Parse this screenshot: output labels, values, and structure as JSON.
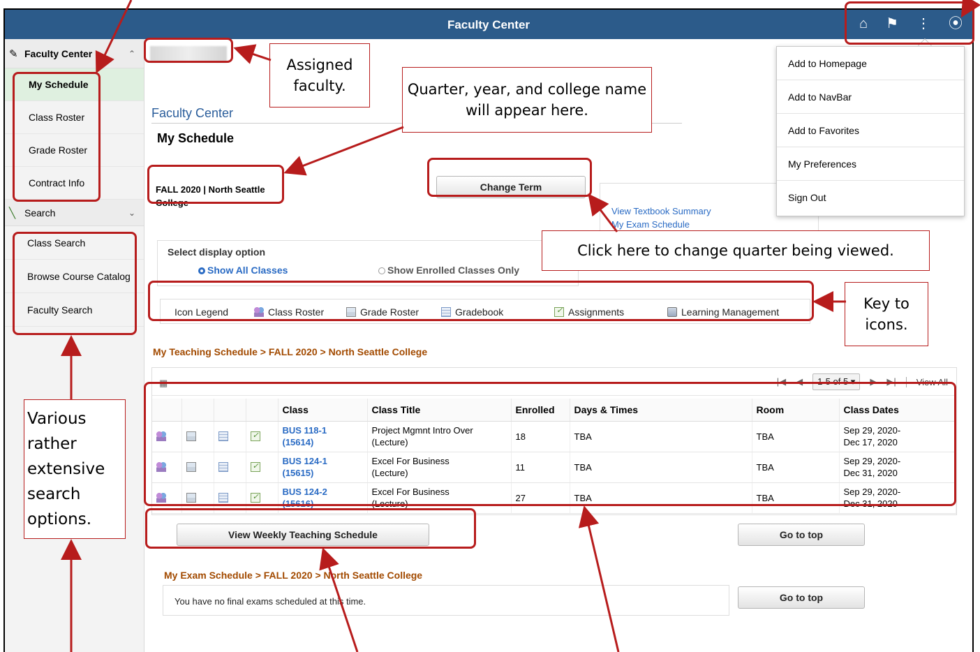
{
  "header": {
    "title": "Faculty Center"
  },
  "header_icons": [
    "home-icon",
    "flag-icon",
    "more-vertical-icon",
    "compass-icon"
  ],
  "sidebar": {
    "group_title": "Faculty Center",
    "items": [
      {
        "label": "My Schedule"
      },
      {
        "label": "Class Roster"
      },
      {
        "label": "Grade Roster"
      },
      {
        "label": "Contract Info"
      }
    ],
    "search_title": "Search",
    "search_items": [
      {
        "label": "Class Search"
      },
      {
        "label": "Browse Course Catalog"
      },
      {
        "label": "Faculty Search"
      }
    ]
  },
  "main": {
    "breadcrumb_link": "Faculty Center",
    "heading": "My Schedule",
    "term_name": "FALL 2020 | North Seattle College",
    "change_term_label": "Change Term",
    "links": {
      "textbook": "View Textbook Summary",
      "exam": "My Exam Schedule"
    },
    "display_option": {
      "label": "Select display option",
      "option_all": "Show All Classes",
      "option_enrolled": "Show Enrolled Classes Only"
    },
    "legend": {
      "title": "Icon Legend",
      "class_roster": "Class Roster",
      "grade_roster": "Grade Roster",
      "gradebook": "Gradebook",
      "assignments": "Assignments",
      "lms": "Learning Management"
    },
    "teaching_title": "My Teaching Schedule > FALL 2020 > North Seattle College",
    "pager": {
      "range": "1-5 of 5",
      "view_all": "View All"
    },
    "table": {
      "headers": [
        "Class",
        "Class Title",
        "Enrolled",
        "Days & Times",
        "Room",
        "Class Dates"
      ],
      "rows": [
        {
          "class": "BUS 118-1",
          "class_id": "(15614)",
          "title": "Project Mgmnt Intro Over",
          "title_sub": "(Lecture)",
          "enrolled": "18",
          "days": "TBA",
          "room": "TBA",
          "dates_1": "Sep 29, 2020-",
          "dates_2": "Dec 17, 2020"
        },
        {
          "class": "BUS 124-1",
          "class_id": "(15615)",
          "title": "Excel For Business",
          "title_sub": "(Lecture)",
          "enrolled": "11",
          "days": "TBA",
          "room": "TBA",
          "dates_1": "Sep 29, 2020-",
          "dates_2": "Dec 31, 2020"
        },
        {
          "class": "BUS 124-2",
          "class_id": "(15616)",
          "title": "Excel For Business",
          "title_sub": "(Lecture)",
          "enrolled": "27",
          "days": "TBA",
          "room": "TBA",
          "dates_1": "Sep 29, 2020-",
          "dates_2": "Dec 31, 2020"
        }
      ]
    },
    "weekly_button": "View Weekly Teaching Schedule",
    "go_top": "Go to top",
    "exam_title": "My Exam Schedule > FALL 2020 > North Seattle College",
    "exam_message": "You have no final exams scheduled at this time."
  },
  "menu": {
    "items": [
      "Add to Homepage",
      "Add to NavBar",
      "Add to Favorites",
      "My Preferences",
      "Sign Out"
    ]
  },
  "annotations": {
    "assigned_faculty": "Assigned faculty.",
    "term_note": "Quarter, year, and college name will appear here.",
    "change_note": "Click here to change quarter being viewed.",
    "key_note": "Key to icons.",
    "search_note": "Various rather extensive search options.",
    "color": "#b71c1c"
  }
}
